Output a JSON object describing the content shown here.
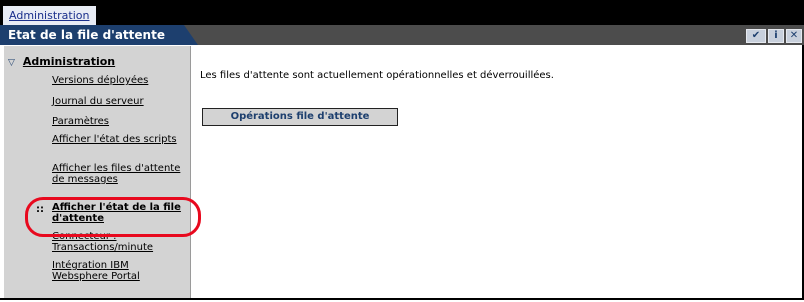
{
  "top_tab": {
    "label": "Administration"
  },
  "window": {
    "title": "Etat de la file d'attente",
    "icons": [
      "checkmark-icon",
      "info-icon",
      "close-icon"
    ],
    "icon_glyphs": {
      "check": "✔",
      "info": "i",
      "close": "✕"
    }
  },
  "sidebar": {
    "root_label": "Administration",
    "items": [
      {
        "label": "Versions déployées"
      },
      {
        "label": "Journal du serveur"
      },
      {
        "label": "Paramètres"
      },
      {
        "label": "Afficher l'état des scripts"
      },
      {
        "label": "Afficher les files d'attente de messages"
      },
      {
        "label": "Afficher l'état de la file d'attente",
        "active": true
      },
      {
        "label": "Connecteur : Transactions/minute"
      },
      {
        "label": "Intégration IBM Websphere Portal"
      }
    ],
    "active_bullet": "::"
  },
  "main": {
    "status_text": "Les files d'attente sont actuellement opérationnelles et déverrouillées.",
    "button_label": "Opérations file d'attente"
  },
  "colors": {
    "title_blue": "#1d3f6e",
    "highlight_red": "#e8091e",
    "sidebar_gray": "#d3d3d3"
  }
}
